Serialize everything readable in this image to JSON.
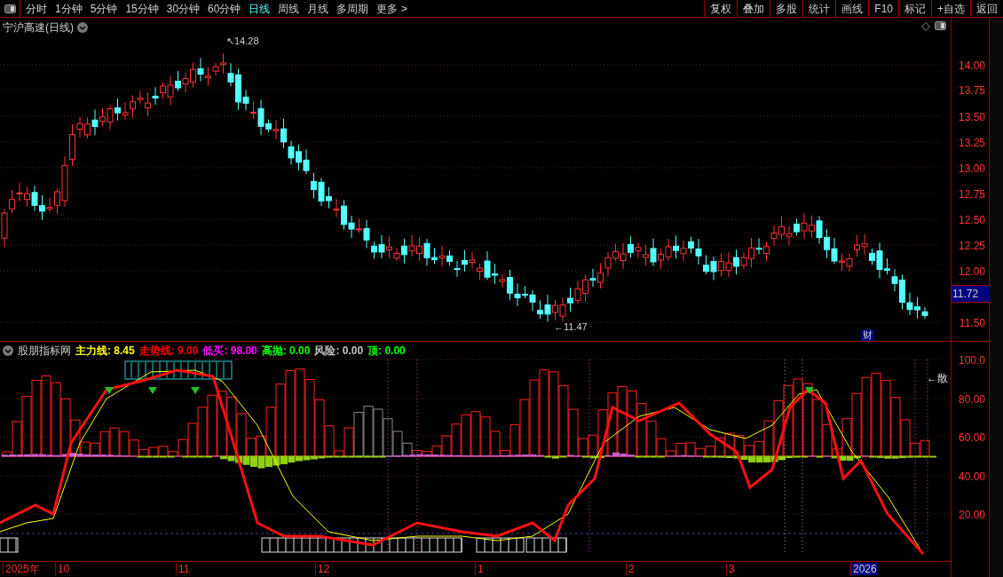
{
  "toolbar": {
    "periods": [
      {
        "label": "分时",
        "selected": false
      },
      {
        "label": "1分钟",
        "selected": false
      },
      {
        "label": "5分钟",
        "selected": false
      },
      {
        "label": "15分钟",
        "selected": false
      },
      {
        "label": "30分钟",
        "selected": false
      },
      {
        "label": "60分钟",
        "selected": false
      },
      {
        "label": "日线",
        "selected": true
      },
      {
        "label": "周线",
        "selected": false
      },
      {
        "label": "月线",
        "selected": false
      },
      {
        "label": "多周期",
        "selected": false
      },
      {
        "label": "更多 >",
        "selected": false
      }
    ],
    "buttons": [
      "复权",
      "叠加",
      "多股",
      "统计",
      "画线",
      "F10",
      "标记",
      "+自选",
      "返回"
    ]
  },
  "price_chart": {
    "title": "宁沪高速(日线)",
    "high_marker": "↖14.28",
    "low_marker": "←11.47",
    "badge": "财",
    "current_price": "11.72",
    "axis_labels": [
      "14.00",
      "13.75",
      "13.50",
      "13.25",
      "13.00",
      "12.75",
      "12.50",
      "12.25",
      "12.00",
      "11.50"
    ]
  },
  "indicator": {
    "title": "股朋指标网",
    "legend": [
      {
        "label": "主力线: 8.45",
        "color": "#ffff00"
      },
      {
        "label": "走势线: 9.00",
        "color": "#ff0000"
      },
      {
        "label": "低买: 98.00",
        "color": "#ff00ff"
      },
      {
        "label": "高抛: 0.00",
        "color": "#00ff00"
      },
      {
        "label": "风险: 0.00",
        "color": "#c0c0c0"
      },
      {
        "label": "顶: 0.00",
        "color": "#00ff00"
      }
    ],
    "note": "←散",
    "axis_labels": [
      "100.0",
      "80.00",
      "60.00",
      "40.00",
      "20.00"
    ]
  },
  "date_axis": [
    {
      "label": "2025年",
      "selected": false
    },
    {
      "label": "10",
      "selected": false
    },
    {
      "label": "11",
      "selected": false
    },
    {
      "label": "12",
      "selected": false
    },
    {
      "label": "1",
      "selected": false
    },
    {
      "label": "2",
      "selected": false
    },
    {
      "label": "3",
      "selected": false
    },
    {
      "label": "2026",
      "selected": true
    }
  ]
}
